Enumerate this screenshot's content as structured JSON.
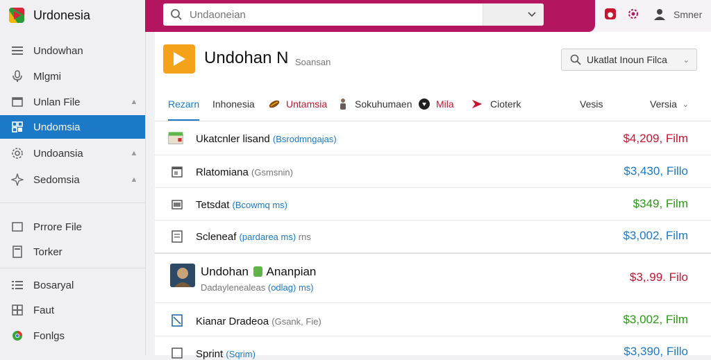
{
  "brand": {
    "name": "Urdonesia"
  },
  "search": {
    "placeholder": "Undaoneian"
  },
  "topbar": {
    "user_name": "Smner"
  },
  "sidebar": {
    "items": [
      {
        "label": "Undowhan",
        "icon": "menu-icon"
      },
      {
        "label": "Mlgmi",
        "icon": "mic-icon"
      },
      {
        "label": "Unlan File",
        "icon": "window-icon"
      },
      {
        "label": "Undomsia",
        "icon": "grid-icon"
      },
      {
        "label": "Undoansia",
        "icon": "gear-icon"
      },
      {
        "label": "Sedomsia",
        "icon": "star-icon"
      },
      {
        "label": "Prrore File",
        "icon": "square-icon"
      },
      {
        "label": "Torker",
        "icon": "document-icon"
      },
      {
        "label": "Bosaryal",
        "icon": "list-icon"
      },
      {
        "label": "Faut",
        "icon": "grid-plus-icon"
      },
      {
        "label": "Fonlgs",
        "icon": "chrome-icon"
      }
    ]
  },
  "header": {
    "title": "Undohan N",
    "subtitle": "Soansan",
    "filter_label": "Ukatlat  Inoun Filca"
  },
  "tabs": [
    {
      "label": "Rezarn",
      "icon": ""
    },
    {
      "label": "Inhonesia",
      "icon": ""
    },
    {
      "label": "Untamsia",
      "icon": "bean-icon"
    },
    {
      "label": "Sokuhumaen",
      "icon": "figure-icon"
    },
    {
      "label": "Mila",
      "icon": "mila-icon"
    },
    {
      "label": "Cioterk",
      "icon": "arrow-icon"
    },
    {
      "label": "Vesis",
      "icon": ""
    },
    {
      "label": "Versia",
      "icon": ""
    }
  ],
  "rows": [
    {
      "name": "Ukatcnler lisand",
      "sub": "(Bsrodmngajas)",
      "price": "$4,209, Film",
      "icon": "package-icon"
    },
    {
      "name": "Rlatomiana",
      "sub": "(Gsmsnin)",
      "price": "$3,430, Fillo",
      "icon": "file-icon"
    },
    {
      "name": "Tetsdat",
      "sub": "(Bcowmq ms)",
      "price": "$349, Film",
      "icon": "window-icon"
    },
    {
      "name": "Scleneaf",
      "sub": "(pardarea ms)",
      "price": "$3,002, Film",
      "icon": "document-icon"
    },
    {
      "name": "Undohan",
      "name2": "Ananpian",
      "sub_prefix": "Dadaylenealeas",
      "sub": "(odlag) ms)",
      "price": "$3,.99. Filo",
      "icon": "avatar-icon"
    },
    {
      "name": "Kianar Dradeoa",
      "sub": "(Gsank, Fie)",
      "price": "$3,002, Film",
      "icon": "edit-icon"
    },
    {
      "name": "Sprint",
      "sub": "(Sqrim)",
      "price": "$3,390, Fillo",
      "icon": "document-icon"
    }
  ]
}
